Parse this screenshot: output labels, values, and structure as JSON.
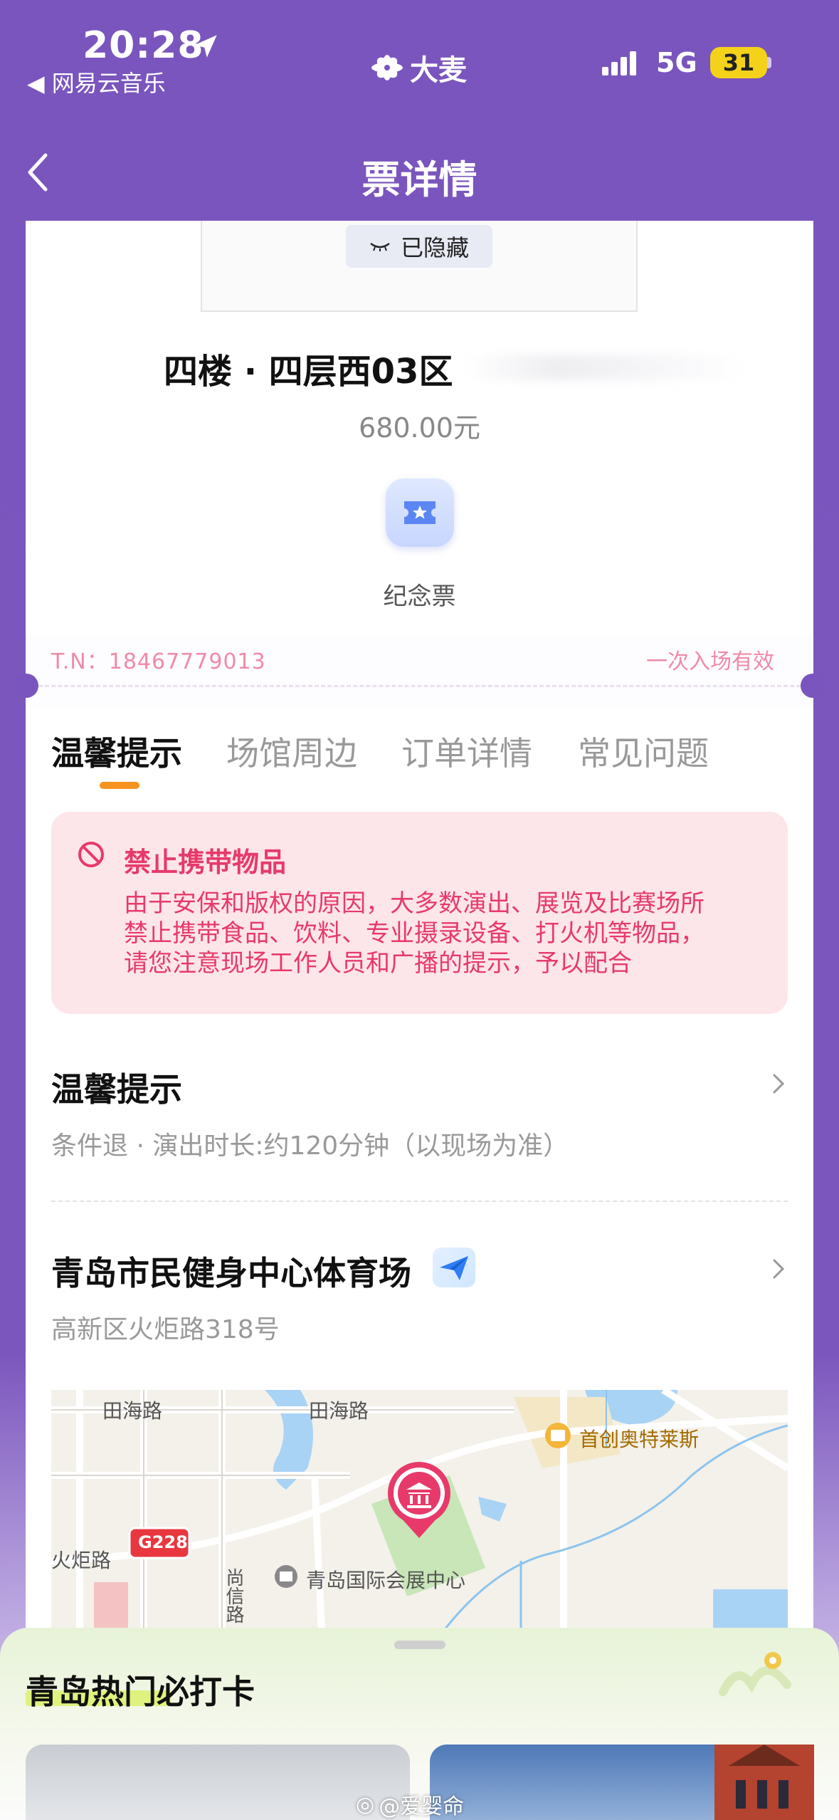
{
  "status_bar": {
    "time": "20:28",
    "back_app": "◀ 网易云音乐",
    "carrier_logo": "大麦",
    "network": "5G",
    "battery": "31"
  },
  "header": {
    "title": "票详情"
  },
  "ticket": {
    "hidden_badge": "已隐藏",
    "seat": "四楼 · 四层西03区",
    "price": "680.00元",
    "souvenir_label": "纪念票",
    "tn": "T.N：18467779013",
    "validity": "一次入场有效"
  },
  "tabs": [
    {
      "label": "温馨提示"
    },
    {
      "label": "场馆周边"
    },
    {
      "label": "订单详情"
    },
    {
      "label": "常见问题"
    }
  ],
  "warning": {
    "title": "禁止携带物品",
    "lines": [
      "由于安保和版权的原因，大多数演出、展览及比赛场所",
      "禁止携带食品、饮料、专业摄录设备、打火机等物品，",
      "请您注意现场工作人员和广播的提示，予以配合"
    ]
  },
  "tips_row": {
    "title": "温馨提示",
    "subtitle": "条件退 · 演出时长:约120分钟（以现场为准）"
  },
  "venue_row": {
    "title": "青岛市民健身中心体育场",
    "address": "高新区火炬路318号"
  },
  "map": {
    "labels": {
      "road1": "田海路",
      "road2": "田海路",
      "poi_outlet": "首创奥特莱斯",
      "road3": "火炬路",
      "highway": "G228",
      "poi_center": "青岛国际会展中心",
      "road4": "尚信路"
    }
  },
  "bottom_sheet": {
    "title": "青岛热门必打卡"
  },
  "watermark": "@爱婴命",
  "colors": {
    "brand_purple": "#7a55bd",
    "accent_pink": "#e73a6a",
    "tab_underline": "#f7931e"
  }
}
